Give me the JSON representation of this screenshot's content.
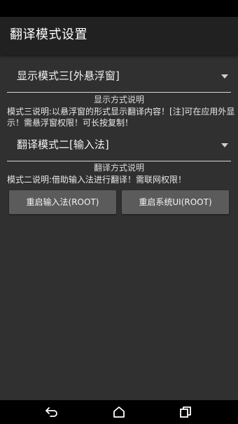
{
  "app": {
    "title": "翻译模式设置"
  },
  "display_mode": {
    "selected": "显示模式三[外悬浮窗]",
    "description_title": "显示方式说明",
    "description_text": "模式三说明:以悬浮窗的形式显示翻译内容！[注]可在应用外显示！需悬浮窗权限！可长按复制！"
  },
  "translate_mode": {
    "selected": "翻译模式二[输入法]",
    "description_title": "翻译方式说明",
    "description_text": "模式二说明:借助输入法进行翻译！需联网权限！"
  },
  "buttons": {
    "restart_ime": "重启输入法(ROOT)",
    "restart_systemui": "重启系统UI(ROOT)"
  },
  "icons": {
    "spinner": "chevron-down-icon",
    "nav_back": "back-icon",
    "nav_home": "home-icon",
    "nav_recents": "recents-icon"
  },
  "colors": {
    "background": "#303030",
    "toolbar": "#212121",
    "button": "#5b5b5b",
    "text": "#ffffff"
  }
}
